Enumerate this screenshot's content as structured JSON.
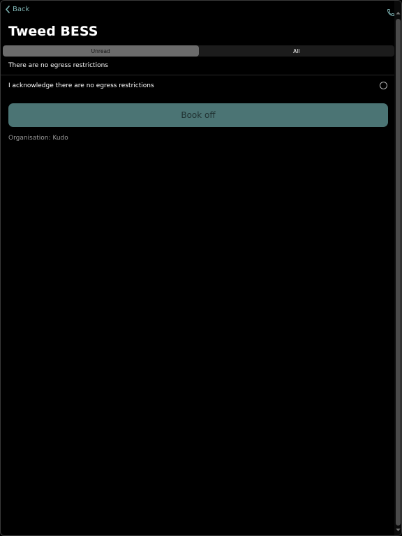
{
  "header": {
    "back_label": "Back",
    "title": "Tweed BESS",
    "accent_color": "#7fb5b5"
  },
  "tabs": [
    {
      "label": "Unread",
      "active": true
    },
    {
      "label": "All",
      "active": false
    }
  ],
  "notice": {
    "text": "There are no egress restrictions"
  },
  "acknowledge": {
    "label": "I acknowledge there are no egress restrictions",
    "checked": false
  },
  "primary_action": {
    "label": "Book off",
    "color": "#4b7474"
  },
  "organisation": {
    "text": "Organisation: Kudo"
  },
  "icons": {
    "back": "chevron-left-icon",
    "call": "phone-icon"
  }
}
